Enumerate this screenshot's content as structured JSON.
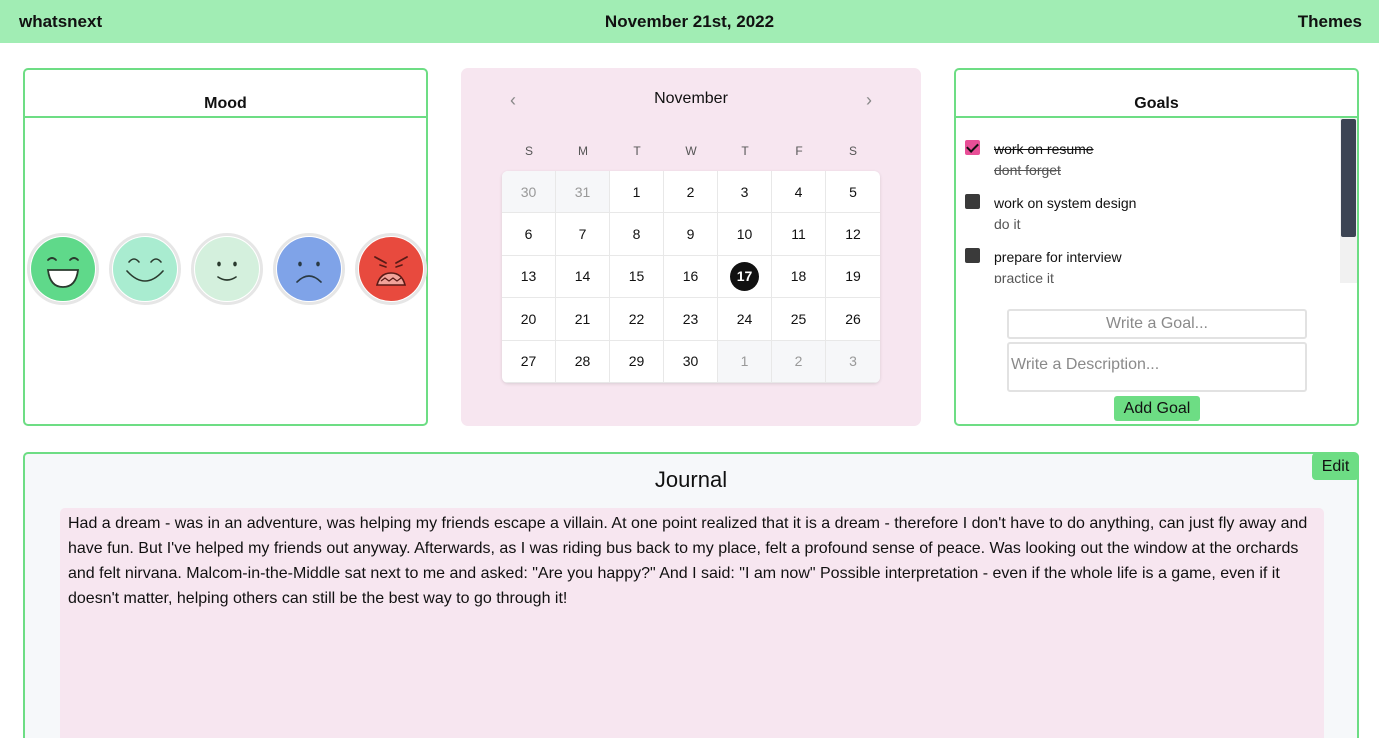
{
  "app": {
    "name": "whatsnext",
    "date": "November 21st, 2022",
    "themes_label": "Themes"
  },
  "mood": {
    "title": "Mood",
    "faces": [
      {
        "name": "laughing",
        "color": "#5fd98a"
      },
      {
        "name": "content",
        "color": "#a9ecd0"
      },
      {
        "name": "neutral-smile",
        "color": "#d4f0dd"
      },
      {
        "name": "sad",
        "color": "#7fa3e8"
      },
      {
        "name": "angry",
        "color": "#e84a3e"
      }
    ]
  },
  "calendar": {
    "month": "November",
    "prev_icon": "‹",
    "next_icon": "›",
    "weekdays": [
      "S",
      "M",
      "T",
      "W",
      "T",
      "F",
      "S"
    ],
    "days": [
      {
        "label": "30",
        "out": true
      },
      {
        "label": "31",
        "out": true
      },
      {
        "label": "1"
      },
      {
        "label": "2"
      },
      {
        "label": "3"
      },
      {
        "label": "4"
      },
      {
        "label": "5"
      },
      {
        "label": "6"
      },
      {
        "label": "7"
      },
      {
        "label": "8"
      },
      {
        "label": "9"
      },
      {
        "label": "10"
      },
      {
        "label": "11"
      },
      {
        "label": "12"
      },
      {
        "label": "13"
      },
      {
        "label": "14"
      },
      {
        "label": "15"
      },
      {
        "label": "16"
      },
      {
        "label": "17",
        "selected": true
      },
      {
        "label": "18"
      },
      {
        "label": "19"
      },
      {
        "label": "20"
      },
      {
        "label": "21"
      },
      {
        "label": "22"
      },
      {
        "label": "23"
      },
      {
        "label": "24"
      },
      {
        "label": "25"
      },
      {
        "label": "26"
      },
      {
        "label": "27"
      },
      {
        "label": "28"
      },
      {
        "label": "29"
      },
      {
        "label": "30"
      },
      {
        "label": "1",
        "out": true
      },
      {
        "label": "2",
        "out": true
      },
      {
        "label": "3",
        "out": true
      }
    ],
    "background": "#f7e6f0"
  },
  "goals": {
    "title": "Goals",
    "items": [
      {
        "title": "work on resume",
        "description": "dont forget",
        "done": true
      },
      {
        "title": "work on system design",
        "description": "do it",
        "done": false
      },
      {
        "title": "prepare for interview",
        "description": "practice it",
        "done": false
      }
    ],
    "title_placeholder": "Write a Goal...",
    "description_placeholder": "Write a Description...",
    "add_label": "Add Goal"
  },
  "journal": {
    "title": "Journal",
    "edit_label": "Edit",
    "text": "Had a dream - was in an adventure, was helping my friends escape a villain. At one point realized that it is a dream - therefore I don't have to do anything, can just fly away and have fun. But I've helped my friends out anyway. Afterwards, as I was riding bus back to my place, felt a profound sense of peace. Was looking out the window at the orchards and felt nirvana. Malcom-in-the-Middle sat next to me and asked: \"Are you happy?\" And I said: \"I am now\" Possible interpretation - even if the whole life is a game, even if it doesn't matter, helping others can still be the best way to go through it!"
  },
  "colors": {
    "topbar": "#a1edb4",
    "accent": "#6ddd84",
    "checked": "#e84f97"
  }
}
